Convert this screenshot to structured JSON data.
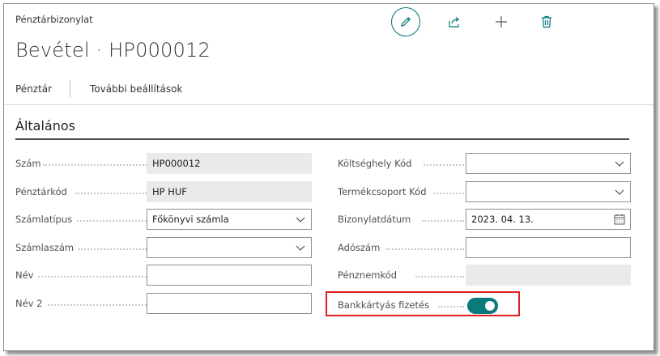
{
  "header": {
    "caption": "Pénztárbizonylat",
    "title": "Bevétel · HP000012",
    "actions": [
      "pencil-icon",
      "share-icon",
      "plus-icon",
      "trash-icon"
    ]
  },
  "tabs": [
    {
      "label": "Pénztár"
    },
    {
      "label": "További beállítások"
    }
  ],
  "section": {
    "title": "Általános"
  },
  "left_fields": [
    {
      "label": "Szám",
      "value": "HP000012",
      "kind": "readonly"
    },
    {
      "label": "Pénztárkód",
      "value": "HP HUF",
      "kind": "readonly"
    },
    {
      "label": "Számlatípus",
      "value": "Főkönyvi számla",
      "kind": "dropdown"
    },
    {
      "label": "Számlaszám",
      "value": "",
      "kind": "dropdown"
    },
    {
      "label": "Név",
      "value": "",
      "kind": "input"
    },
    {
      "label": "Név 2",
      "value": "",
      "kind": "input"
    }
  ],
  "right_fields": [
    {
      "label": "Költséghely Kód",
      "value": "",
      "kind": "dropdown"
    },
    {
      "label": "Termékcsoport Kód",
      "value": "",
      "kind": "dropdown"
    },
    {
      "label": "Bizonylatdátum",
      "value": "2023. 04. 13.",
      "kind": "date"
    },
    {
      "label": "Adószám",
      "value": "",
      "kind": "input"
    },
    {
      "label": "Pénznemkód",
      "value": "",
      "kind": "readonly"
    },
    {
      "label": "Bankkártyás fizetés",
      "value": "on",
      "kind": "toggle"
    }
  ],
  "colors": {
    "accent": "#00757a",
    "highlight": "#e02020"
  }
}
